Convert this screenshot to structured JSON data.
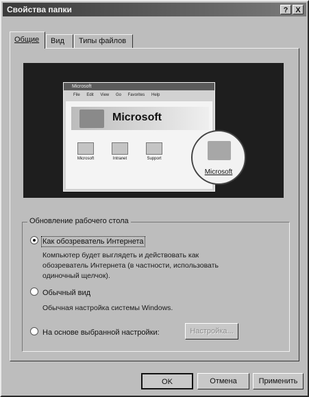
{
  "window": {
    "title": "Свойства папки",
    "help": "?",
    "close": "X"
  },
  "tabs": [
    {
      "label": "Общие"
    },
    {
      "label": "Вид"
    },
    {
      "label": "Типы файлов"
    }
  ],
  "preview": {
    "window_title": "Microsoft",
    "menu": [
      "File",
      "Edit",
      "View",
      "Go",
      "Favorites",
      "Help"
    ],
    "brand": "Microsoft",
    "items": [
      "Microsoft",
      "Intranet",
      "Support"
    ],
    "magnified_label": "Microsoft"
  },
  "group": {
    "title": "Обновление рабочего стола",
    "options": [
      {
        "label": "Как обозреватель Интернета",
        "selected": true
      },
      {
        "label": "Обычный вид",
        "selected": false
      },
      {
        "label": "На основе выбранной настройки:",
        "selected": false
      }
    ],
    "desc_web_lines": [
      "Компьютер будет выглядеть и действовать как",
      "обозреватель Интернета (в частности,  использовать",
      "одиночный щелчок)."
    ],
    "desc_classic": "Обычная настройка системы Windows.",
    "settings_button": "Настройка..."
  },
  "buttons": {
    "ok": "OK",
    "cancel": "Отмена",
    "apply": "Применить"
  }
}
